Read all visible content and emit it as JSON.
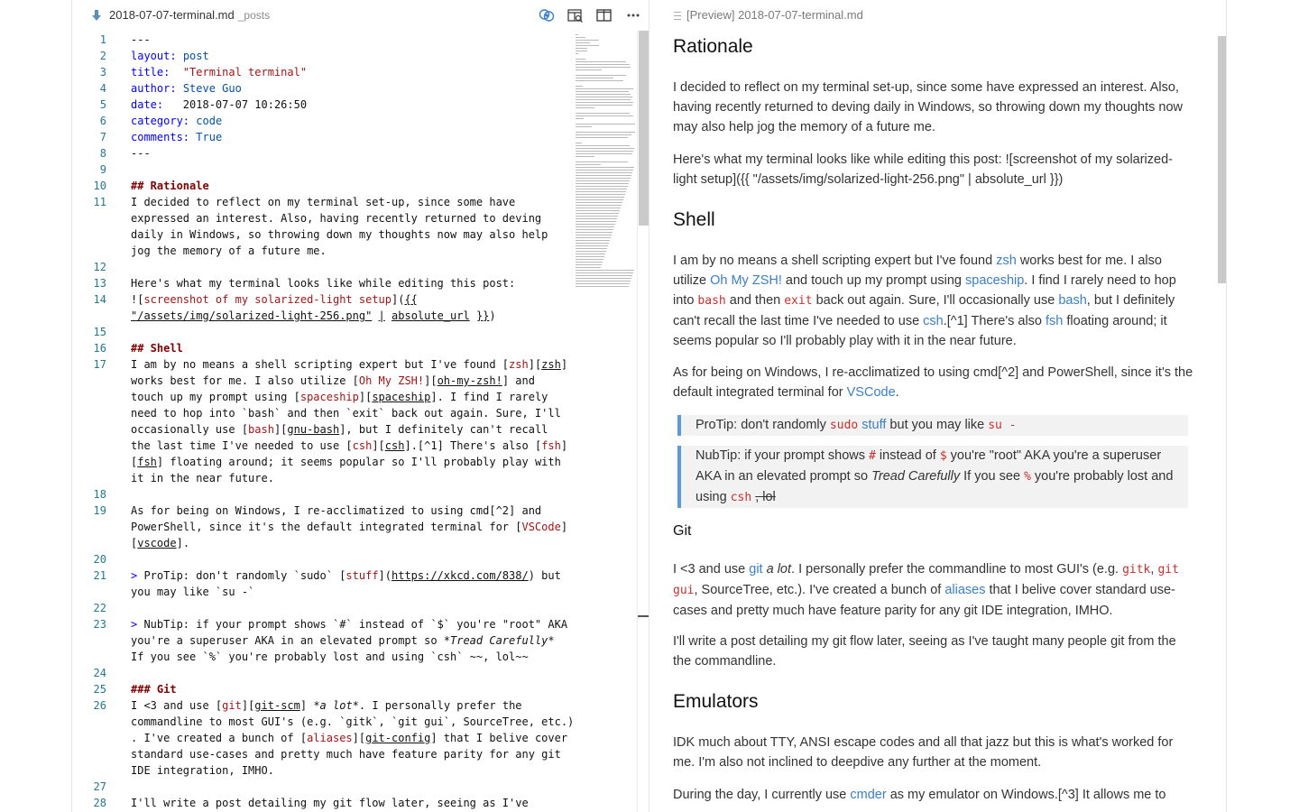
{
  "editor": {
    "tab_title": "2018-07-07-terminal.md",
    "tab_dir": "_posts",
    "actions": [
      "open-changes-icon",
      "open-preview-to-side-icon",
      "split-editor-icon",
      "more-actions-icon"
    ],
    "lines": [
      {
        "n": "1",
        "html": "---"
      },
      {
        "n": "2",
        "html": "<span class=\"k\">layout:</span> <span class=\"v\">post</span>"
      },
      {
        "n": "3",
        "html": "<span class=\"k\">title:</span>  <span class=\"s\">\"Terminal terminal\"</span>"
      },
      {
        "n": "4",
        "html": "<span class=\"k\">author:</span> <span class=\"v\">Steve Guo</span>"
      },
      {
        "n": "5",
        "html": "<span class=\"k\">date:</span>   2018-07-07 10:26:50"
      },
      {
        "n": "6",
        "html": "<span class=\"k\">category:</span> <span class=\"v\">code</span>"
      },
      {
        "n": "7",
        "html": "<span class=\"k\">comments:</span> <span class=\"v\">True</span>"
      },
      {
        "n": "8",
        "html": "---"
      },
      {
        "n": "9",
        "html": ""
      },
      {
        "n": "10",
        "html": "<span class=\"h\">## Rationale</span>"
      },
      {
        "n": "11",
        "html": "I decided to reflect on my terminal set-up, since some have"
      },
      {
        "n": "",
        "html": "expressed an interest. Also, having recently returned to deving"
      },
      {
        "n": "",
        "html": "daily in Windows, so throwing down my thoughts now may also help"
      },
      {
        "n": "",
        "html": "jog the memory of a future me."
      },
      {
        "n": "12",
        "html": ""
      },
      {
        "n": "13",
        "html": "Here's what my terminal looks like while editing this post:"
      },
      {
        "n": "14",
        "html": "![<span class=\"lt\">screenshot of my solarized-light setup</span>](<span class=\"u\">{{</span>"
      },
      {
        "n": "",
        "html": "<span class=\"u\">\"/assets/img/solarized-light-256.png\"</span> <span class=\"u\">|</span> <span class=\"u\">absolute_url</span> <span class=\"u\">}}</span>)"
      },
      {
        "n": "15",
        "html": ""
      },
      {
        "n": "16",
        "html": "<span class=\"h\">## Shell</span>"
      },
      {
        "n": "17",
        "html": "I am by no means a shell scripting expert but I've found [<span class=\"lt\">zsh</span>][<span class=\"u\">zsh</span>]"
      },
      {
        "n": "",
        "html": "works best for me. I also utilize [<span class=\"lt\">Oh My ZSH!</span>][<span class=\"u\">oh-my-zsh!</span>] and"
      },
      {
        "n": "",
        "html": "touch up my prompt using [<span class=\"lt\">spaceship</span>][<span class=\"u\">spaceship</span>]. I find I rarely"
      },
      {
        "n": "",
        "html": "need to hop into `bash` and then `exit` back out again. Sure, I'll"
      },
      {
        "n": "",
        "html": "occasionally use [<span class=\"lt\">bash</span>][<span class=\"u\">gnu-bash</span>], but I definitely can't recall"
      },
      {
        "n": "",
        "html": "the last time I've needed to use [<span class=\"lt\">csh</span>][<span class=\"u\">csh</span>].[^1] There's also [<span class=\"lt\">fsh</span>]"
      },
      {
        "n": "",
        "html": "[<span class=\"u\">fsh</span>] floating around; it seems popular so I'll probably play with"
      },
      {
        "n": "",
        "html": "it in the near future."
      },
      {
        "n": "18",
        "html": ""
      },
      {
        "n": "19",
        "html": "As for being on Windows, I re-acclimatized to using cmd[^2] and"
      },
      {
        "n": "",
        "html": "PowerShell, since it's the default integrated terminal for [<span class=\"lt\">VSCode</span>]"
      },
      {
        "n": "",
        "html": "[<span class=\"u\">vscode</span>]."
      },
      {
        "n": "20",
        "html": ""
      },
      {
        "n": "21",
        "html": "<span class=\"k\">&gt;</span> ProTip: don't randomly `sudo` [<span class=\"lt\">stuff</span>](<span class=\"u\">https://xkcd.com/838/</span>) but"
      },
      {
        "n": "",
        "html": "you may like `su -`"
      },
      {
        "n": "22",
        "html": ""
      },
      {
        "n": "23",
        "html": "<span class=\"k\">&gt;</span> NubTip: if your prompt shows `#` instead of `$` you're \"root\" AKA"
      },
      {
        "n": "",
        "html": "you're a superuser AKA in an elevated prompt so <i>*Tread Carefully*</i>"
      },
      {
        "n": "",
        "html": "If you see `%` you're probably lost and using `csh` ~~, lol~~"
      },
      {
        "n": "24",
        "html": ""
      },
      {
        "n": "25",
        "html": "<span class=\"h\">### Git</span>"
      },
      {
        "n": "26",
        "html": "I &lt;3 and use [<span class=\"lt\">git</span>][<span class=\"u\">git-scm</span>] <i>*a lot*</i>. I personally prefer the"
      },
      {
        "n": "",
        "html": "commandline to most GUI's (e.g. `gitk`, `git gui`, SourceTree, etc.)"
      },
      {
        "n": "",
        "html": ". I've created a bunch of [<span class=\"lt\">aliases</span>][<span class=\"u\">git-config</span>] that I belive cover"
      },
      {
        "n": "",
        "html": "standard use-cases and pretty much have feature parity for any git"
      },
      {
        "n": "",
        "html": "IDE integration, IMHO."
      },
      {
        "n": "27",
        "html": ""
      },
      {
        "n": "28",
        "html": "I'll write a post detailing my git flow later, seeing as I've"
      }
    ]
  },
  "preview": {
    "tab_title": "[Preview] 2018-07-07-terminal.md",
    "blocks": [
      {
        "kind": "h2",
        "name": "heading-rationale",
        "html": "Rationale"
      },
      {
        "kind": "p",
        "html": "I decided to reflect on my terminal set-up, since some have expressed an interest. Also, having recently returned to deving daily in Windows, so throwing down my thoughts now may also help jog the memory of a future me."
      },
      {
        "kind": "p",
        "html": "Here's what my terminal looks like while editing this post: ![screenshot of my solarized-light setup]({{ \"/assets/img/solarized-light-256.png\" | absolute_url }})"
      },
      {
        "kind": "h2",
        "name": "heading-shell",
        "html": "Shell"
      },
      {
        "kind": "p",
        "html": "I am by no means a shell scripting expert but I've found <span class=\"a\">zsh</span> works best for me. I also utilize <span class=\"a\">Oh My ZSH!</span> and touch up my prompt using <span class=\"a\">spaceship</span>. I find I rarely need to hop into <span class=\"cd\">bash</span> and then <span class=\"cd\">exit</span> back out again. Sure, I'll occasionally use <span class=\"a\">bash</span>, but I definitely can't recall the last time I've needed to use <span class=\"a\">csh</span>.[^1] There's also <span class=\"a\">fsh</span> floating around; it seems popular so I'll probably play with it in the near future."
      },
      {
        "kind": "p",
        "html": "As for being on Windows, I re-acclimatized to using cmd[^2] and PowerShell, since it's the default integrated terminal for <span class=\"a\">VSCode</span>."
      },
      {
        "kind": "quote",
        "html": "ProTip: don't randomly <span class=\"cd\">sudo</span> <span class=\"a\">stuff</span> but you may like <span class=\"cd\">su -</span>"
      },
      {
        "kind": "quote",
        "html": "NubTip: if your prompt shows <span class=\"cd\">#</span> instead of <span class=\"cd\">$</span> you're \"root\" AKA you're a superuser AKA in an elevated prompt so <span class=\"em\">Tread Carefully</span> If you see <span class=\"cd\">%</span> you're probably lost and using <span class=\"cd\">csh</span> <span class=\"strike\">, lol</span>"
      },
      {
        "kind": "h3",
        "name": "heading-git",
        "html": "Git"
      },
      {
        "kind": "p",
        "html": "I &lt;3 and use <span class=\"a\">git</span> <span class=\"em\">a lot</span>. I personally prefer the commandline to most GUI's (e.g. <span class=\"cd\">gitk</span>, <span class=\"cd\">git gui</span>, SourceTree, etc.). I've created a bunch of <span class=\"a\">aliases</span> that I belive cover standard use-cases and pretty much have feature parity for any git IDE integration, IMHO."
      },
      {
        "kind": "p",
        "html": "I'll write a post detailing my git flow later, seeing as I've taught many people git from the the commandline."
      },
      {
        "kind": "h2",
        "name": "heading-emulators",
        "html": "Emulators"
      },
      {
        "kind": "p",
        "html": "IDK much about TTY, ANSI escape codes and all that jazz but this is what's worked for me. I'm also not inclined to deepdive any further at the moment."
      },
      {
        "kind": "p",
        "html": "During the day, I currently use <span class=\"a\">cmder</span> as my emulator on Windows.[^3] It allows me to"
      }
    ]
  },
  "colors": {
    "accent": "#3a7fc7",
    "line_number": "#237893",
    "keyword": "#0000ff",
    "string": "#a31515",
    "quote_bar": "#5b9bd5"
  }
}
